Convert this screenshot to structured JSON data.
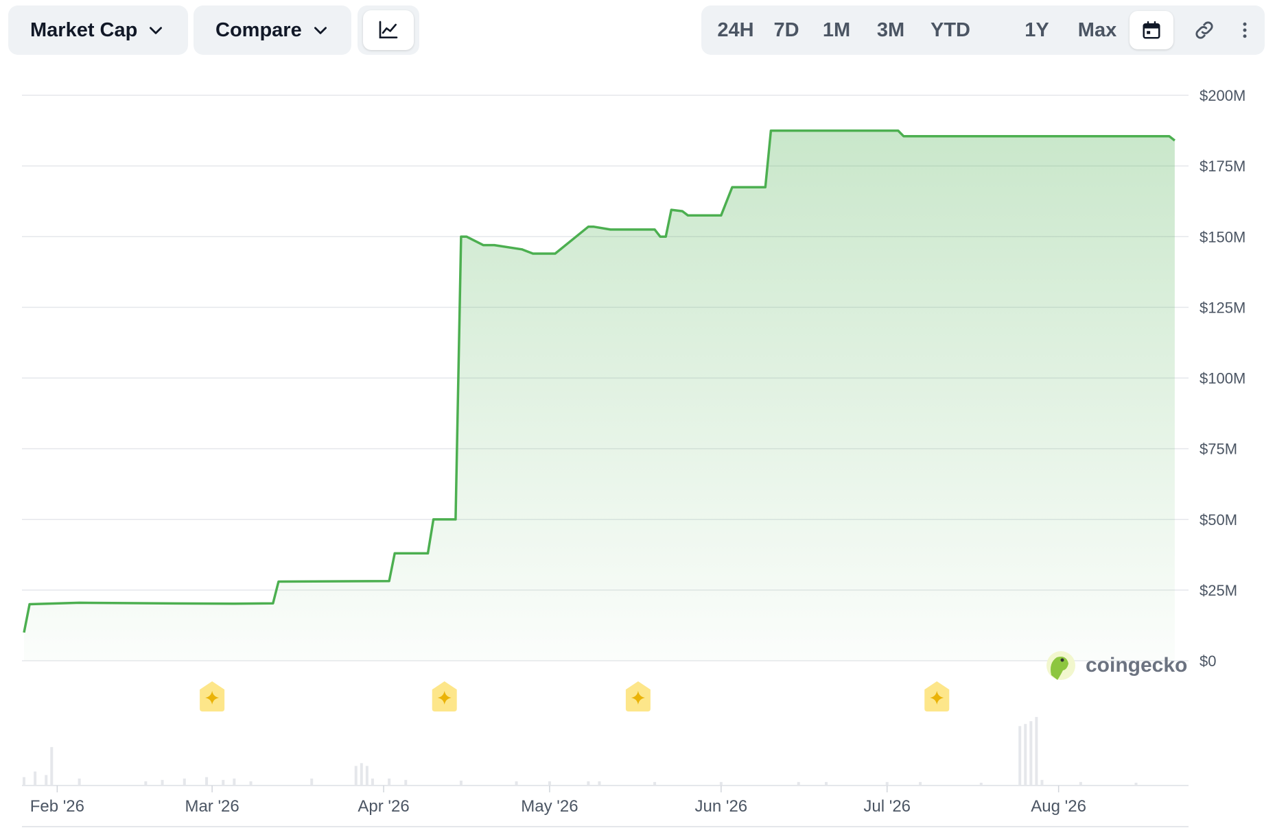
{
  "toolbar": {
    "metric_label": "Market Cap",
    "compare_label": "Compare",
    "chart_type_icon": "line-chart-icon",
    "ranges": [
      "24H",
      "7D",
      "1M",
      "3M",
      "YTD",
      "1Y",
      "Max"
    ],
    "calendar_icon": "calendar-icon",
    "link_icon": "link-icon",
    "more_icon": "more-vertical-icon"
  },
  "watermark": {
    "text": "coingecko"
  },
  "colors": {
    "line": "#4caf50",
    "area": "#c8e6c9",
    "event_marker": "#fde68a",
    "event_star": "#eab308",
    "volume_bar": "#e5e7eb",
    "grid": "#e5e7eb"
  },
  "events": {
    "icon": "sparkle-event-icon",
    "dates": [
      "2026-03-01",
      "2026-04-12",
      "2026-05-17",
      "2026-07-10"
    ]
  },
  "chart_data": {
    "type": "area",
    "title": "",
    "xlabel": "",
    "ylabel": "",
    "x_ticks": [
      "Feb '26",
      "Mar '26",
      "Apr '26",
      "May '26",
      "Jun '26",
      "Jul '26",
      "Aug '26"
    ],
    "y_ticks": [
      "$200M",
      "$175M",
      "$150M",
      "$125M",
      "$100M",
      "$75M",
      "$50M",
      "$25M",
      "$0"
    ],
    "ylim": [
      0,
      200
    ],
    "y_unit": "USD millions",
    "xlim": [
      "2026-01-26",
      "2026-08-23"
    ],
    "grid": true,
    "series": [
      {
        "x": [
          "2026-01-26",
          "2026-01-27",
          "2026-02-05",
          "2026-02-20",
          "2026-03-05",
          "2026-03-12",
          "2026-03-13",
          "2026-04-02",
          "2026-04-03",
          "2026-04-09",
          "2026-04-10",
          "2026-04-14",
          "2026-04-15",
          "2026-04-16",
          "2026-04-19",
          "2026-04-21",
          "2026-04-26",
          "2026-04-28",
          "2026-05-02",
          "2026-05-08",
          "2026-05-09",
          "2026-05-12",
          "2026-05-13",
          "2026-05-20",
          "2026-05-21",
          "2026-05-22",
          "2026-05-23",
          "2026-05-25",
          "2026-05-26",
          "2026-05-27",
          "2026-05-28",
          "2026-06-01",
          "2026-06-03",
          "2026-06-04",
          "2026-06-09",
          "2026-06-10",
          "2026-07-03",
          "2026-07-04",
          "2026-08-21",
          "2026-08-22"
        ],
        "values": [
          10,
          20,
          20.5,
          20.3,
          20.2,
          20.3,
          28,
          28.2,
          38,
          38,
          50,
          50,
          150,
          150,
          147,
          147,
          145.5,
          144,
          144,
          153.5,
          153.5,
          152.5,
          152.5,
          152.5,
          150,
          150,
          159.5,
          159,
          157.5,
          157.5,
          157.5,
          157.5,
          167.5,
          167.5,
          167.5,
          187.5,
          187.5,
          185.5,
          185.5,
          184
        ]
      }
    ],
    "volume": {
      "x": [
        "2026-01-26",
        "2026-01-28",
        "2026-01-30",
        "2026-01-31",
        "2026-02-05",
        "2026-02-17",
        "2026-02-20",
        "2026-02-24",
        "2026-02-28",
        "2026-03-03",
        "2026-03-05",
        "2026-03-08",
        "2026-03-19",
        "2026-03-27",
        "2026-03-28",
        "2026-03-29",
        "2026-03-30",
        "2026-04-02",
        "2026-04-05",
        "2026-04-15",
        "2026-04-25",
        "2026-05-01",
        "2026-05-08",
        "2026-05-10",
        "2026-05-20",
        "2026-06-01",
        "2026-06-15",
        "2026-06-20",
        "2026-07-01",
        "2026-07-07",
        "2026-07-18",
        "2026-07-25",
        "2026-07-26",
        "2026-07-27",
        "2026-07-28",
        "2026-07-29",
        "2026-08-05",
        "2026-08-15"
      ],
      "values": [
        0.12,
        0.2,
        0.15,
        0.55,
        0.1,
        0.06,
        0.08,
        0.1,
        0.12,
        0.08,
        0.1,
        0.06,
        0.1,
        0.28,
        0.32,
        0.28,
        0.1,
        0.1,
        0.08,
        0.07,
        0.06,
        0.06,
        0.06,
        0.06,
        0.05,
        0.05,
        0.05,
        0.05,
        0.05,
        0.05,
        0.04,
        0.85,
        0.88,
        0.92,
        0.98,
        0.08,
        0.05,
        0.04
      ]
    }
  }
}
